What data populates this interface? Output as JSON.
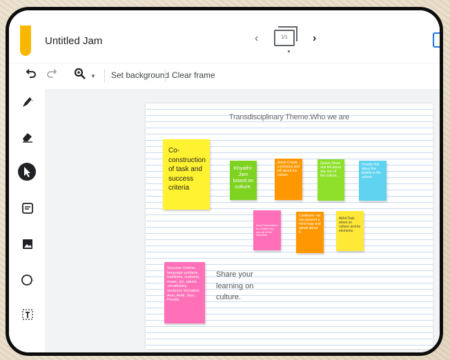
{
  "app": {
    "title": "Untitled Jam"
  },
  "nav": {
    "prev": "‹",
    "next": "›",
    "frame_counter": "1/1"
  },
  "toolbar": {
    "undo_icon": "undo-icon",
    "redo_icon": "redo-icon",
    "zoom_icon": "zoom-icon",
    "set_background": "Set background",
    "clear_frame": "Clear frame"
  },
  "sidebar": {
    "tools": [
      "pen-icon",
      "eraser-icon",
      "select-arrow-icon",
      "sticky-note-icon",
      "image-icon",
      "circle-shape-icon",
      "text-box-icon"
    ]
  },
  "board": {
    "title": "Transdisciplinary Theme:Who we are",
    "notes": [
      {
        "id": "coconstruction",
        "color": "#fff230",
        "text": "Co-construction of task and success criteria"
      },
      {
        "id": "khyathi",
        "color": "#7ed321",
        "text": "Khyathi-Jam board on culture."
      },
      {
        "id": "anish",
        "color": "#ff9800",
        "text": "Anish-Create a persona and tell about his culture."
      },
      {
        "id": "gease",
        "color": "#8ee02a",
        "text": "Gease-Show and tell about any one of the culture.."
      },
      {
        "id": "preethi",
        "color": "#5fd3f0",
        "text": "Preethi-Tell about the beliefs in the culture."
      },
      {
        "id": "anvi",
        "color": "#ff70b8",
        "text": "Anvi-Presentation on Culture any one all of the elements"
      },
      {
        "id": "cowthami",
        "color": "#ff9800",
        "text": "Cowthami- we can present a mind map and speak about it."
      },
      {
        "id": "akhil",
        "color": "#ffe836",
        "text": "Akhil-Task sheet on culture and its elements."
      },
      {
        "id": "success",
        "color": "#ff70b8",
        "text": "Success Criteria- language symbols, traditions, customs, music, art, values ,vocabulary, sentence formation Anvi, Akhil, Sion, Preethi"
      }
    ],
    "share_text": "Share your learning on culture."
  },
  "colors": {
    "frame": "#0d0d0d",
    "logo": "#f9b800",
    "accent": "#1a73e8"
  }
}
